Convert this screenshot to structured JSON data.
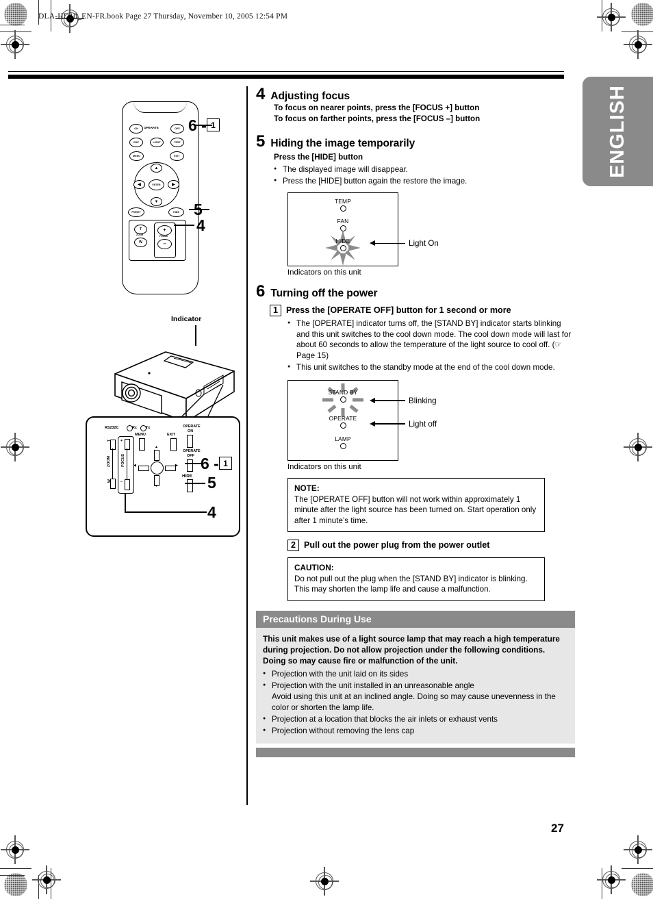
{
  "header": {
    "imprint": "DLA-HD10_EN-FR.book  Page 27  Thursday, November 10, 2005  12:54 PM"
  },
  "language_tab": {
    "label": "ENGLISH"
  },
  "page_number": "27",
  "left_column": {
    "remote": {
      "callouts": [
        {
          "num": "6 -",
          "box": "1"
        },
        {
          "num": "5"
        },
        {
          "num": "4"
        }
      ],
      "buttons": {
        "on": "ON",
        "operate": "OPERATE",
        "off": "OFF",
        "comp": "CMP",
        "light": "LIGHT",
        "test": "TEST",
        "menu": "MENU",
        "exit": "EXIT",
        "enter": "ENTER",
        "preset": "PRESET",
        "hide": "HIDE",
        "zoom_t": "T",
        "zoom_label": "ZOOM",
        "zoom_w": "W",
        "focus_label": "FOCUS",
        "focus_plus": "+",
        "focus_minus": "–"
      }
    },
    "projector": {
      "indicator_label": "Indicator"
    },
    "panel": {
      "rs232c": "RS232C",
      "rx": "Rx",
      "tx": "Tx",
      "menu": "MENU",
      "exit": "EXIT",
      "operate_on": "OPERATE\nON",
      "operate_on_l1": "OPERATE",
      "operate_on_l2": "ON",
      "operate_off_l1": "OPERATE",
      "operate_off_l2": "OFF",
      "hide": "HIDE",
      "zoom": "ZOOM",
      "zoom_t": "T",
      "zoom_w": "W",
      "focus": "FOCUS",
      "focus_plus": "+",
      "focus_minus": "–",
      "callouts": [
        {
          "num": "6 -",
          "box": "1"
        },
        {
          "num": "5"
        },
        {
          "num": "4"
        }
      ]
    }
  },
  "steps": [
    {
      "num": "4",
      "title": "Adjusting focus",
      "lines": [
        "To focus on nearer points, press the [FOCUS +] button",
        "To focus on farther points, press the [FOCUS –] button"
      ]
    },
    {
      "num": "5",
      "title": "Hiding the image temporarily",
      "sub": "Press the [HIDE] button",
      "bullets": [
        "The displayed image will disappear.",
        "Press the [HIDE] button again the restore the image."
      ]
    },
    {
      "num": "6",
      "title": "Turning off the power"
    }
  ],
  "diagram_hide": {
    "indicators": [
      {
        "name": "TEMP",
        "state": "off"
      },
      {
        "name": "FAN",
        "state": "off"
      },
      {
        "name": "HIDE",
        "state": "on"
      }
    ],
    "annotation": "Light On",
    "caption": "Indicators on this unit"
  },
  "diagram_power": {
    "indicators": [
      {
        "name": "STAND BY",
        "state": "blinking"
      },
      {
        "name": "OPERATE",
        "state": "off"
      },
      {
        "name": "LAMP",
        "state": "off"
      }
    ],
    "annotations": [
      "Blinking",
      "Light off"
    ],
    "caption": "Indicators on this unit"
  },
  "substeps": [
    {
      "num": "1",
      "title": "Press the [OPERATE OFF] button for 1 second or more",
      "bullets": [
        "The [OPERATE] indicator turns off, the [STAND BY] indicator starts blinking and this unit switches to the cool down mode. The cool down mode will last for about 60 seconds to allow the temperature of the light source to cool off. (☞ Page 15)",
        "This unit switches to the standby mode at the end of the cool down mode."
      ]
    },
    {
      "num": "2",
      "title": "Pull out the power plug from the power outlet"
    }
  ],
  "note_box": {
    "title": "NOTE:",
    "text": "The [OPERATE OFF] button will not work within approximately 1 minute after the light source has been turned on. Start operation only after 1 minute’s time."
  },
  "caution_box": {
    "title": "CAUTION:",
    "text": "Do not pull out the plug when the [STAND BY] indicator is blinking. This may shorten the lamp life and cause a malfunction."
  },
  "precautions": {
    "heading": "Precautions During Use",
    "lead": "This unit makes use of a light source lamp that may reach a high temperature during projection. Do not allow projection under the following conditions. Doing so may cause fire or malfunction of the unit.",
    "items": [
      {
        "bullet": true,
        "text": "Projection with the unit laid on its sides"
      },
      {
        "bullet": true,
        "text": "Projection with the unit installed in an unreasonable angle"
      },
      {
        "bullet": false,
        "text": "Avoid using this unit at an inclined angle. Doing so may cause unevenness in the color or shorten the lamp life."
      },
      {
        "bullet": true,
        "text": "Projection at a location that blocks the air inlets or exhaust vents"
      },
      {
        "bullet": true,
        "text": "Projection without removing the lens cap"
      }
    ]
  },
  "colors": {
    "tab_gray": "#8a8a8a",
    "panel_gray": "#e7e7e7",
    "ink": "#000000"
  }
}
